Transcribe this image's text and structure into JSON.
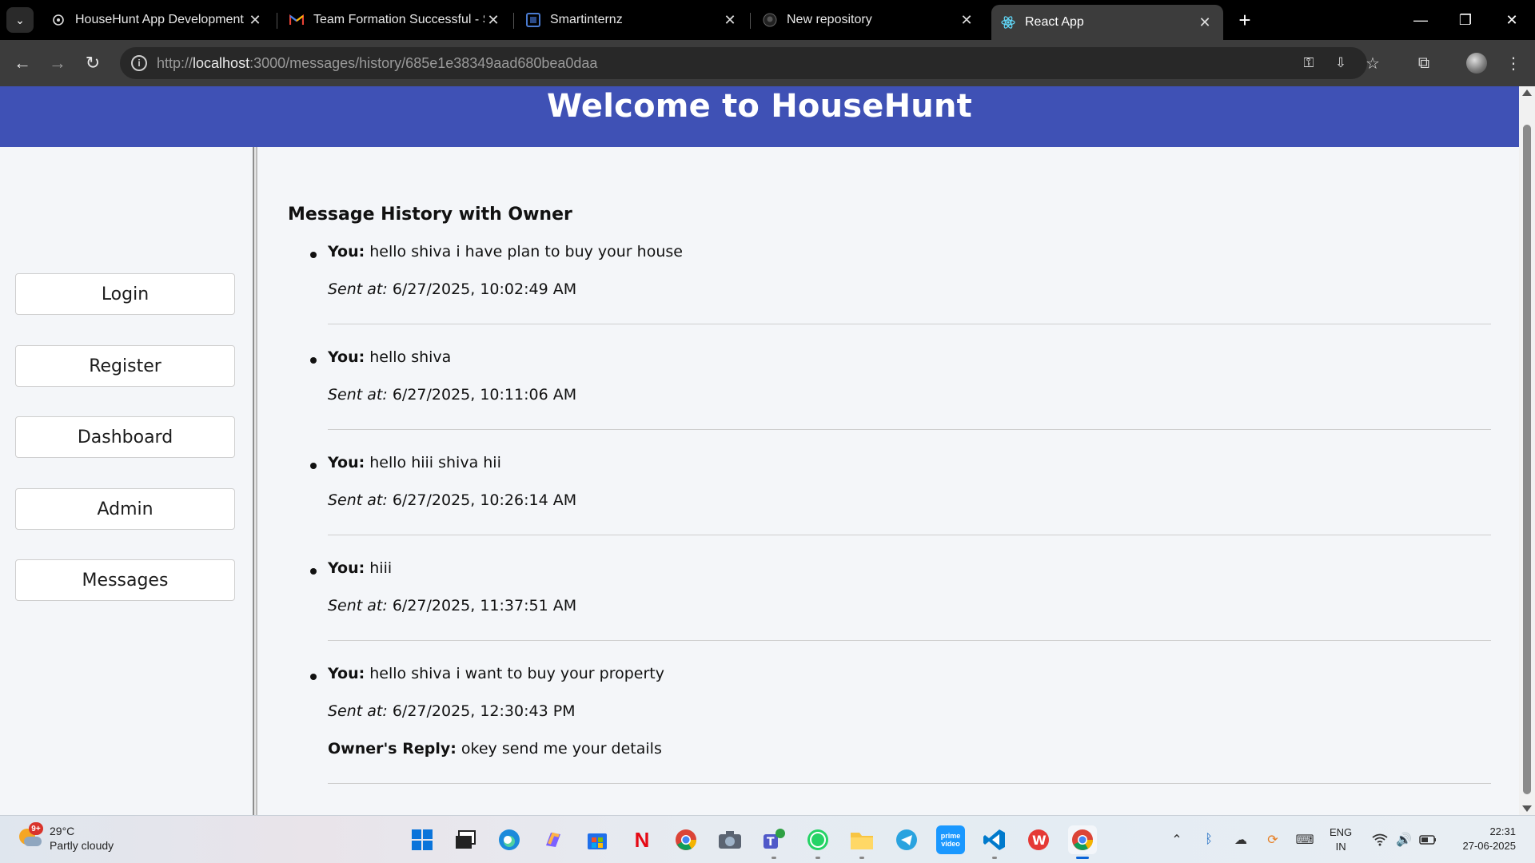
{
  "browser": {
    "tabs": [
      {
        "title": "HouseHunt App Development",
        "icon": "chat-icon",
        "active": false
      },
      {
        "title": "Team Formation Successful - Sm",
        "icon": "gmail-icon",
        "active": false
      },
      {
        "title": "Smartinternz",
        "icon": "smartinternz-icon",
        "active": false
      },
      {
        "title": "New repository",
        "icon": "github-icon",
        "active": false
      },
      {
        "title": "React App",
        "icon": "react-icon",
        "active": true
      }
    ],
    "url": {
      "scheme": "http://",
      "host": "localhost",
      "path": ":3000/messages/history/685e1e38349aad680bea0daa"
    }
  },
  "page": {
    "header_title": "Welcome to HouseHunt",
    "sidebar": {
      "items": [
        "Login",
        "Register",
        "Dashboard",
        "Admin",
        "Messages"
      ]
    },
    "main": {
      "heading": "Message History with Owner",
      "you_label": "You:",
      "sent_label": "Sent at:",
      "reply_label": "Owner's Reply:",
      "messages": [
        {
          "text": "hello shiva i have plan to buy your house",
          "sent_at": "6/27/2025, 10:02:49 AM",
          "reply": ""
        },
        {
          "text": "hello shiva",
          "sent_at": "6/27/2025, 10:11:06 AM",
          "reply": ""
        },
        {
          "text": "hello hiii shiva hii",
          "sent_at": "6/27/2025, 10:26:14 AM",
          "reply": ""
        },
        {
          "text": "hiii",
          "sent_at": "6/27/2025, 11:37:51 AM",
          "reply": ""
        },
        {
          "text": "hello shiva i want to buy your property",
          "sent_at": "6/27/2025, 12:30:43 PM",
          "reply": "okey send me your details"
        }
      ]
    }
  },
  "taskbar": {
    "weather": {
      "temp": "29°C",
      "condition": "Partly cloudy",
      "badge": "9+"
    },
    "lang": {
      "line1": "ENG",
      "line2": "IN"
    },
    "clock": {
      "time": "22:31",
      "date": "27-06-2025"
    }
  },
  "colors": {
    "header": "#3f51b5",
    "page_bg": "#f4f6f9",
    "chrome_bg": "#000000",
    "toolbar_bg": "#3c3c3c"
  }
}
